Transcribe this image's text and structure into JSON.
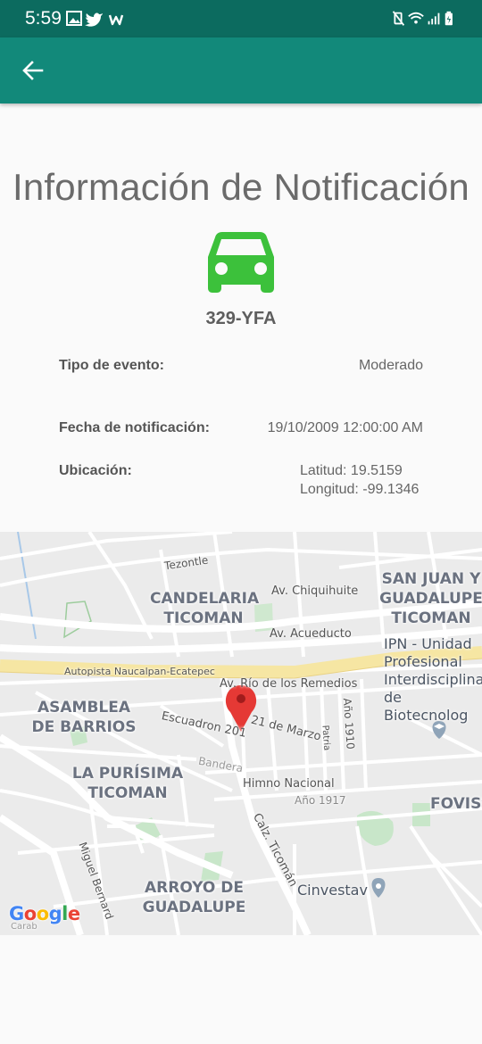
{
  "status_bar": {
    "time": "5:59",
    "left_icons": [
      "image-icon",
      "twitter-icon",
      "w-app-icon"
    ],
    "right_icons": [
      "vibrate-mute-icon",
      "wifi-icon",
      "signal-icon",
      "battery-charging-icon"
    ]
  },
  "app_bar": {
    "back_icon": "arrow-left-icon",
    "color": "#12897a",
    "status_color": "#0c6b5f"
  },
  "page": {
    "title": "Información de Notificación",
    "vehicle_icon": "car-icon",
    "vehicle_icon_color": "#3cc13b",
    "plate": "329-YFA"
  },
  "details": {
    "event_label": "Tipo de evento:",
    "event_value": "Moderado",
    "date_label": "Fecha de notificación:",
    "date_value": "19/10/2009 12:00:00 AM",
    "location_label": "Ubicación:",
    "latitude": "Latitud: 19.5159",
    "longitude": "Longitud: -99.1346"
  },
  "map": {
    "neighborhoods": {
      "candelaria": "CANDELARIA\nTICOMAN",
      "san_juan": "SAN JUAN Y\nGUADALUPE\nTICOMAN",
      "asamblea": "ASAMBLEA\nDE BARRIOS",
      "purisima": "LA PURÍSIMA\nTICOMAN",
      "arroyo": "ARROYO DE\nGUADALUPE",
      "fovissste": "FOVISS"
    },
    "streets": {
      "tezontle": "Tezontle",
      "chiquihuite": "Av. Chiquihuite",
      "acueducto": "Av. Acueducto",
      "autopista": "Autopista Naucalpan-Ecatepec",
      "remedios": "Av. Río de los Remedios",
      "escuadron": "Escuadron 201",
      "marzo": "21 de Marzo",
      "ano1910": "Año 1910",
      "patria": "Patria",
      "bandera": "Bandera",
      "himno": "Himno Nacional",
      "ano1917": "Año 1917",
      "ticoman": "Calz. Ticomán",
      "miguel": "Miguel Bernard",
      "carab": "Carab"
    },
    "pois": {
      "ipn": "IPN - Unidad\nProfesional\nInterdisciplinar\nde Biotecnolog",
      "cinvestav": "Cinvestav"
    },
    "marker_icon": "map-pin-icon",
    "marker_color": "#e53935",
    "logo_text": "Google"
  }
}
